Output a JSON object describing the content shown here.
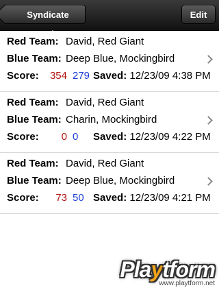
{
  "navbar": {
    "back_label": "Syndicate Spades",
    "edit_label": "Edit"
  },
  "labels": {
    "red_team": "Red Team:",
    "blue_team": "Blue Team:",
    "score": "Score:",
    "saved": "Saved:"
  },
  "games": [
    {
      "red_team": "David, Red Giant",
      "blue_team": "Deep Blue, Mockingbird",
      "red_score": "354",
      "blue_score": "279",
      "saved": "12/23/09 4:38 PM"
    },
    {
      "red_team": "David, Red Giant",
      "blue_team": "Charin, Mockingbird",
      "red_score": "0",
      "blue_score": "0",
      "saved": "12/23/09 4:22 PM"
    },
    {
      "red_team": "David, Red Giant",
      "blue_team": "Deep Blue, Mockingbird",
      "red_score": "73",
      "blue_score": "50",
      "saved": "12/23/09 4:21 PM"
    }
  ],
  "watermark": {
    "logo_pre": "Pla",
    "logo_y": "y",
    "logo_post": "tform",
    "url": "www.playtform.net"
  },
  "colors": {
    "red_score": "#b3120e",
    "blue_score": "#1c3ed4",
    "watermark_accent": "#f2a21a"
  },
  "icons": [
    "back-arrow-icon",
    "chevron-right-icon"
  ]
}
